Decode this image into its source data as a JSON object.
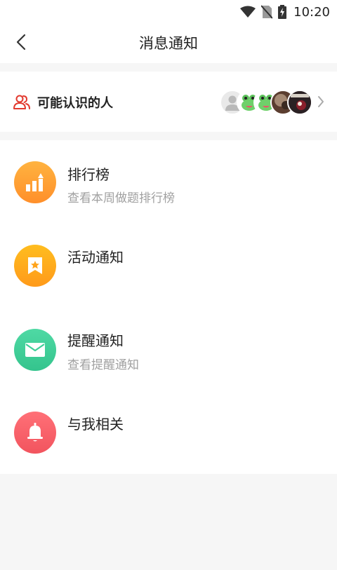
{
  "status": {
    "time": "10:20"
  },
  "header": {
    "title": "消息通知"
  },
  "people": {
    "label": "可能认识的人"
  },
  "items": [
    {
      "title": "排行榜",
      "subtitle": "查看本周做题排行榜",
      "icon": "bar-chart-up-icon",
      "color": "#ffa233"
    },
    {
      "title": "活动通知",
      "subtitle": "",
      "icon": "bookmark-star-icon",
      "color": "#ffad1a"
    },
    {
      "title": "提醒通知",
      "subtitle": "查看提醒通知",
      "icon": "envelope-icon",
      "color": "#3ecf97"
    },
    {
      "title": "与我相关",
      "subtitle": "",
      "icon": "bell-icon",
      "color": "#f5616b"
    }
  ],
  "colors": {
    "people_icon": "#e23a2f",
    "subtitle": "#a0a0a0"
  }
}
